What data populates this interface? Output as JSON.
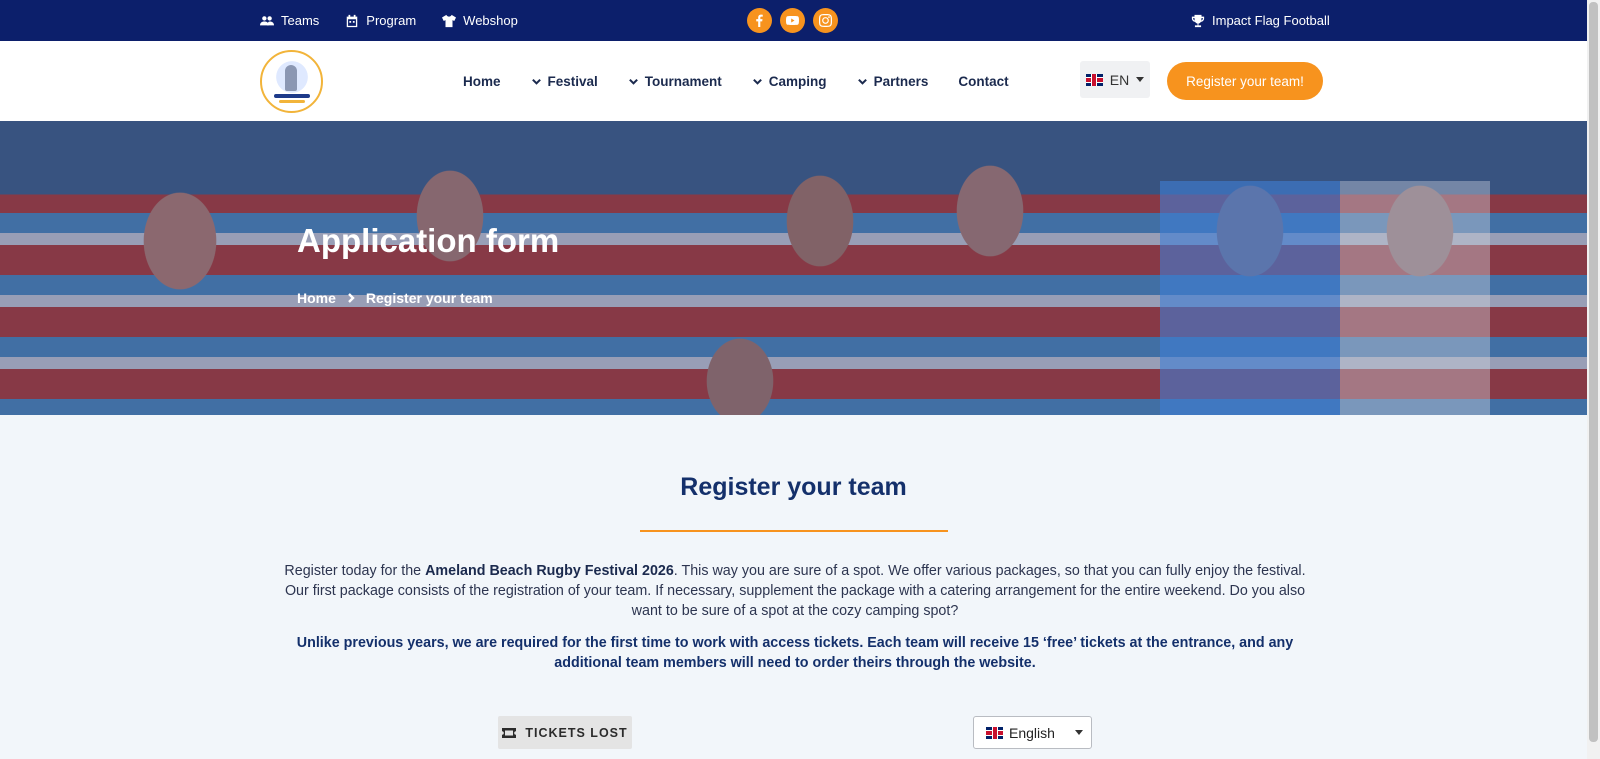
{
  "topbar": {
    "links": [
      {
        "label": "Teams",
        "icon": "users-icon"
      },
      {
        "label": "Program",
        "icon": "calendar-icon"
      },
      {
        "label": "Webshop",
        "icon": "shirt-icon"
      }
    ],
    "social": [
      "facebook-icon",
      "youtube-icon",
      "instagram-icon"
    ],
    "right_link": "Impact Flag Football",
    "bg_color": "#0c1f6b",
    "accent_color": "#f7931e"
  },
  "header": {
    "nav": [
      {
        "label": "Home",
        "dropdown": false
      },
      {
        "label": "Festival",
        "dropdown": true
      },
      {
        "label": "Tournament",
        "dropdown": true
      },
      {
        "label": "Camping",
        "dropdown": true
      },
      {
        "label": "Partners",
        "dropdown": true
      },
      {
        "label": "Contact",
        "dropdown": false
      }
    ],
    "language": "EN",
    "cta_label": "Register your team!"
  },
  "hero": {
    "title": "Application form",
    "breadcrumb": [
      "Home",
      "Register your team"
    ]
  },
  "main": {
    "title": "Register your team",
    "intro_prefix": "Register today for the ",
    "intro_bold": "Ameland Beach Rugby Festival 2026",
    "intro_suffix": ". This way you are sure of a spot. We offer various packages, so that you can fully enjoy the festival. Our first package consists of the registration of your team. If necessary, supplement the package with a catering arrangement for the entire weekend. Do you also want to be sure of a spot at the cozy camping spot?",
    "notice": "Unlike previous years, we are required for the first time to work with access tickets. Each team will receive 15 ‘free’ tickets at the entrance, and any additional team members will need to order theirs through the website.",
    "tickets_button": "TICKETS LOST",
    "form_language": "English"
  }
}
